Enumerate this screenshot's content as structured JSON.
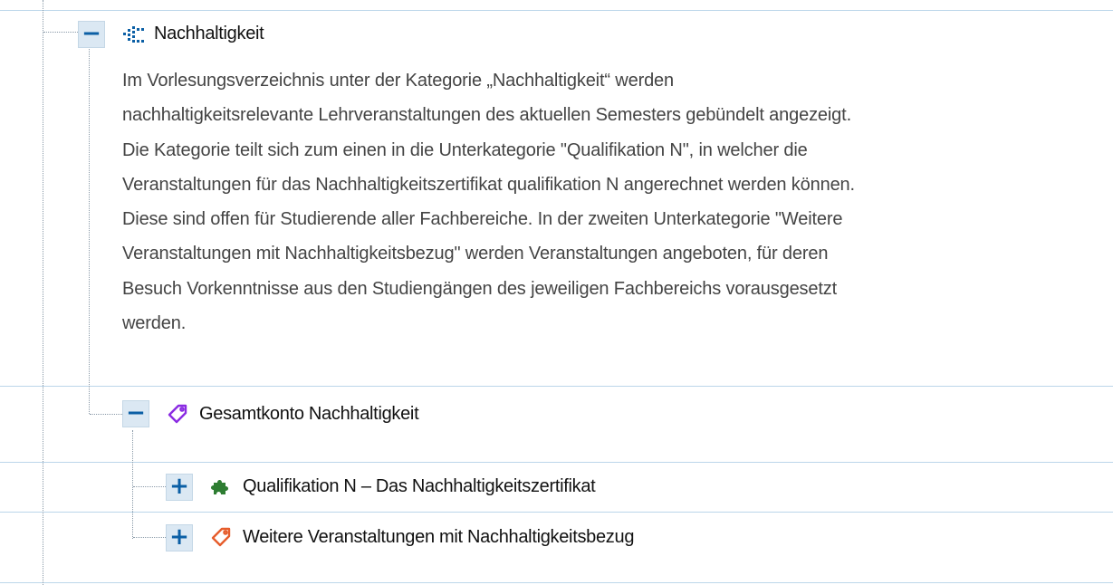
{
  "tree": {
    "root": {
      "toggle": "−",
      "label": "Nachhaltigkeit",
      "icon": "dots-grid-icon",
      "description_lines": [
        "Im Vorlesungsverzeichnis unter der Kategorie „Nachhaltigkeit“ werden",
        "nachhaltigkeitsrelevante Lehrveranstaltungen des aktuellen Semesters gebündelt angezeigt.",
        "Die Kategorie teilt sich zum einen in die Unterkategorie \"Qualifikation N\", in welcher die",
        "Veranstaltungen für das Nachhaltigkeitszertifikat qualifikation N angerechnet werden können.",
        "Diese sind offen für Studierende aller Fachbereiche. In der zweiten Unterkategorie \"Weitere",
        "Veranstaltungen mit Nachhaltigkeitsbezug\" werden Veranstaltungen angeboten, für deren",
        "Besuch Vorkenntnisse aus den Studiengängen des jeweiligen Fachbereichs vorausgesetzt",
        "werden."
      ]
    },
    "account": {
      "toggle": "−",
      "label": "Gesamtkonto Nachhaltigkeit",
      "icon": "tag-icon",
      "icon_color": "#8a2be2"
    },
    "children": [
      {
        "toggle": "+",
        "label": "Qualifikation N – Das Nachhaltigkeitszertifikat",
        "icon": "puzzle-icon",
        "icon_color": "#2e7d32"
      },
      {
        "toggle": "+",
        "label": "Weitere Veranstaltungen mit Nachhaltigkeitsbezug",
        "icon": "tag-icon",
        "icon_color": "#e65c2b"
      }
    ]
  }
}
